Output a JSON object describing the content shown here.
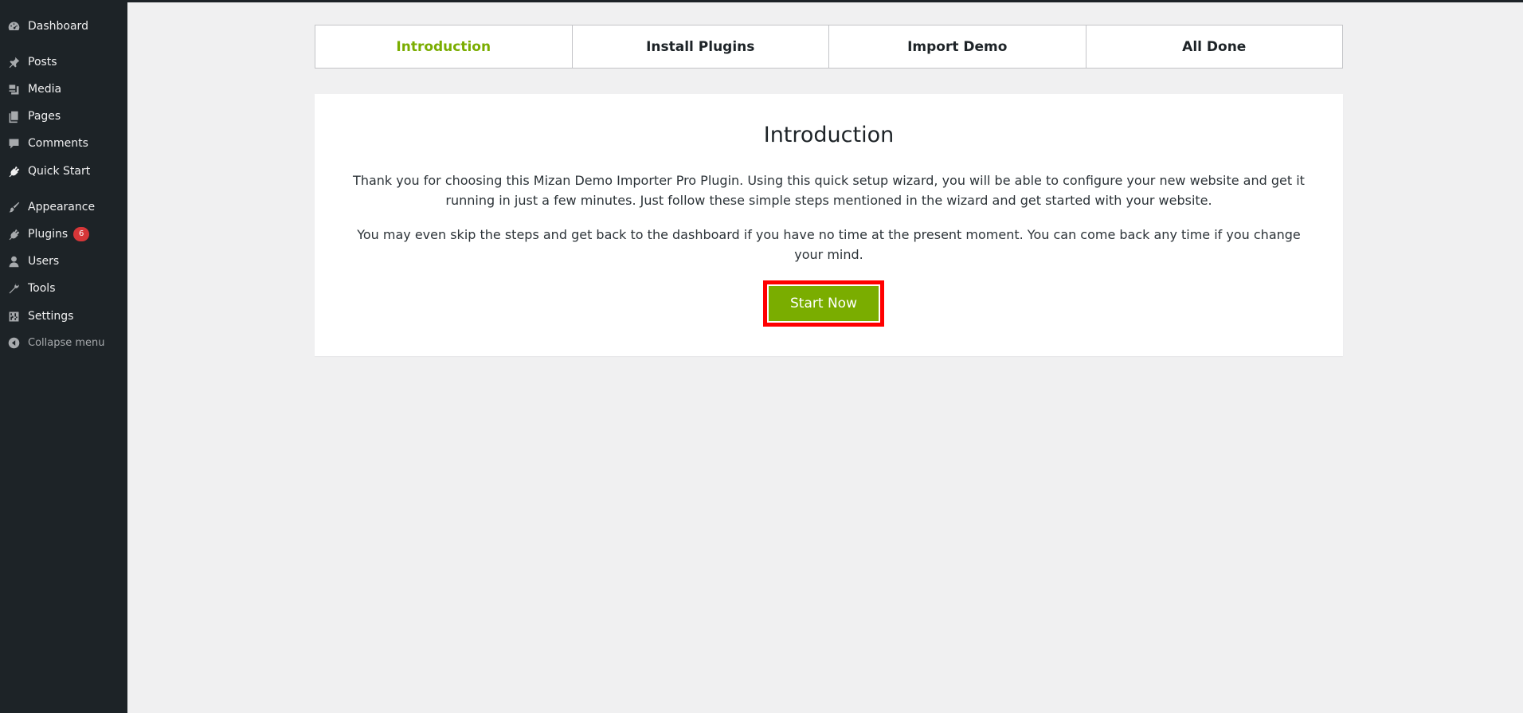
{
  "sidebar": {
    "items": [
      {
        "label": "Dashboard",
        "icon": "dashboard-icon"
      },
      {
        "label": "Posts",
        "icon": "pin-icon"
      },
      {
        "label": "Media",
        "icon": "media-icon"
      },
      {
        "label": "Pages",
        "icon": "pages-icon"
      },
      {
        "label": "Comments",
        "icon": "comment-icon"
      },
      {
        "label": "Quick Start",
        "icon": "plug-icon"
      },
      {
        "label": "Appearance",
        "icon": "paintbrush-icon"
      },
      {
        "label": "Plugins",
        "icon": "plugin-icon",
        "badge": "6"
      },
      {
        "label": "Users",
        "icon": "user-icon"
      },
      {
        "label": "Tools",
        "icon": "wrench-icon"
      },
      {
        "label": "Settings",
        "icon": "settings-icon"
      }
    ],
    "collapse_label": "Collapse menu"
  },
  "wizard": {
    "steps": [
      "Introduction",
      "Install Plugins",
      "Import Demo",
      "All Done"
    ],
    "active_step": "Introduction"
  },
  "content": {
    "title": "Introduction",
    "paragraph_1": "Thank you for choosing this Mizan Demo Importer Pro Plugin. Using this quick setup wizard, you will be able to configure your new website and get it running in just a few minutes. Just follow these simple steps mentioned in the wizard and get started with your website.",
    "paragraph_2": "You may even skip the steps and get back to the dashboard if you have no time at the present moment. You can come back any time if you change your mind.",
    "start_button_label": "Start Now"
  },
  "colors": {
    "accent": "#7aad00",
    "sidebar_bg": "#1d2327",
    "highlight": "#ff0000",
    "badge": "#d63638"
  }
}
